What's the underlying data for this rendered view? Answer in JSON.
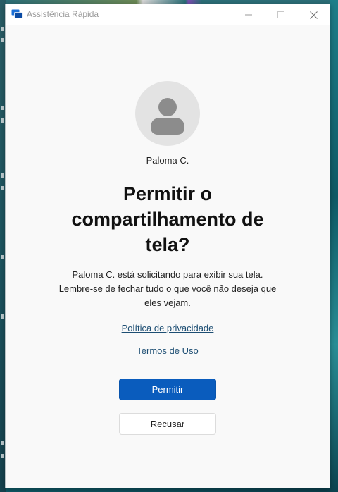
{
  "window": {
    "title": "Assistência Rápida",
    "controls": {
      "minimize_icon": "minimize-icon",
      "maximize_icon": "maximize-icon",
      "close_icon": "close-icon"
    }
  },
  "request": {
    "user_name": "Paloma C.",
    "title": "Permitir o compartilhamento de tela?",
    "body": "Paloma C. está solicitando para exibir sua tela. Lembre-se de fechar tudo o que você não deseja que eles vejam.",
    "privacy_link": "Política de privacidade",
    "terms_link": "Termos de Uso",
    "allow_label": "Permitir",
    "decline_label": "Recusar"
  },
  "colors": {
    "accent": "#0a5cbd",
    "link": "#1d4e73",
    "background": "#f9f9f9"
  }
}
